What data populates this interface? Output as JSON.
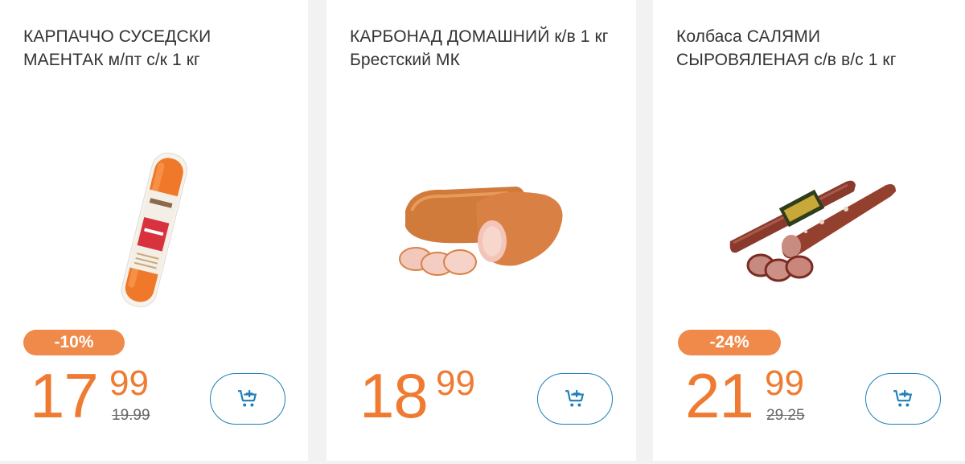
{
  "products": [
    {
      "title": "КАРПАЧЧО СУСЕДСКИ МАЕНТАК м/пт с/к 1 кг",
      "discount": "-10%",
      "price_whole": "17",
      "price_fraction": "99",
      "old_price": "19.99",
      "image": "carpaccio-sausage-photo",
      "cart_icon": "cart-plus-icon"
    },
    {
      "title": "КАРБОНАД ДОМАШНИЙ к/в 1 кг Брестский МК",
      "discount": "",
      "price_whole": "18",
      "price_fraction": "99",
      "old_price": "",
      "image": "smoked-pork-loin-photo",
      "cart_icon": "cart-plus-icon"
    },
    {
      "title": "Колбаса САЛЯМИ СЫРОВЯЛЕНАЯ с/в в/с 1 кг",
      "discount": "-24%",
      "price_whole": "21",
      "price_fraction": "99",
      "old_price": "29.25",
      "image": "salami-sausage-photo",
      "cart_icon": "cart-plus-icon"
    }
  ],
  "colors": {
    "price": "#ef7b32",
    "badge": "#f08a4b",
    "cart_border": "#1f7fb8",
    "title": "#333333",
    "background": "#f2f2f2"
  }
}
